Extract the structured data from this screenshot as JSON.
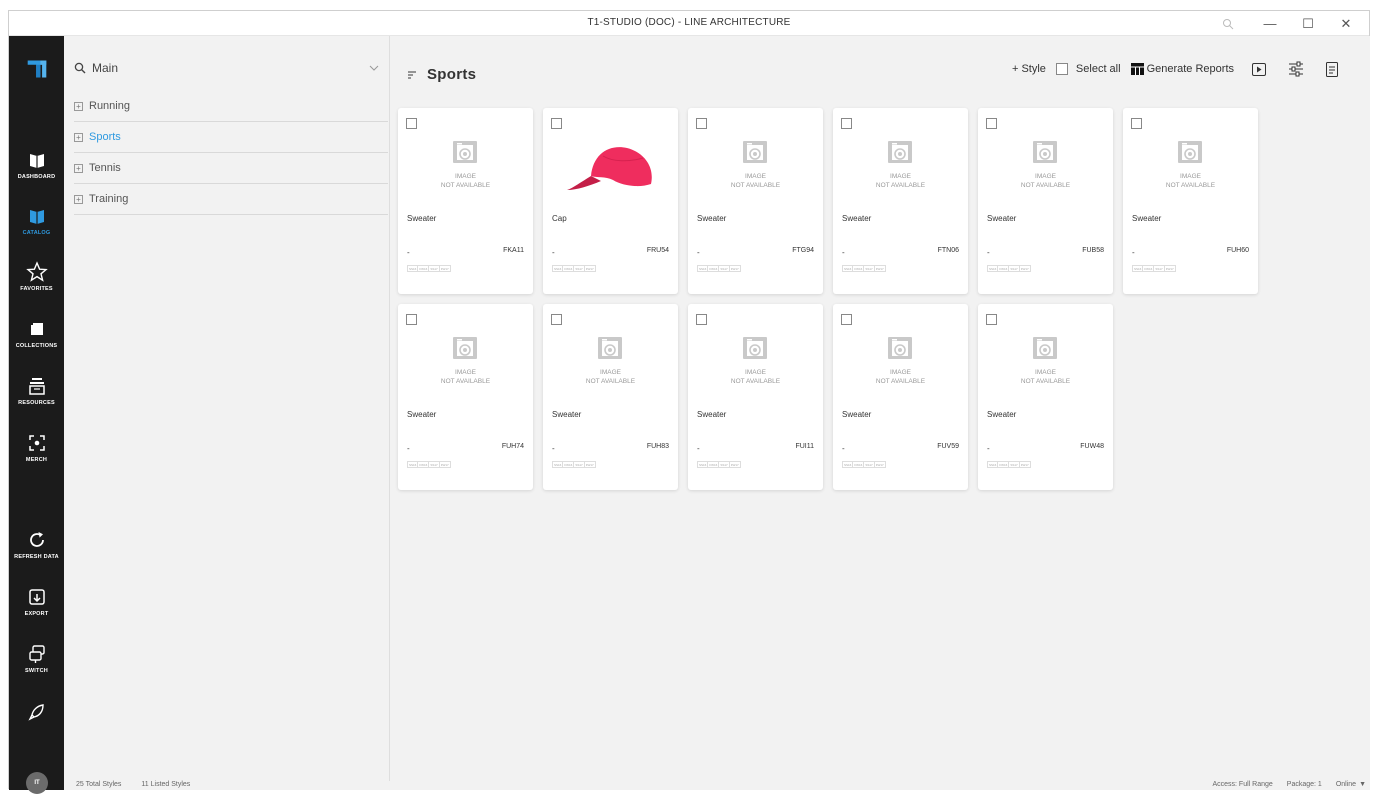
{
  "window": {
    "title": "T1-STUDIO (DOC) - LINE ARCHITECTURE",
    "zoom_icon": "magnifier-icon",
    "minimize_glyph": "—",
    "maximize_glyph": "☐",
    "close_glyph": "✕"
  },
  "rail": {
    "accent_color": "#2f9ae0",
    "items": [
      {
        "label": "DASHBOARD",
        "icon": "book-icon"
      },
      {
        "label": "CATALOG",
        "icon": "catalog-book-icon",
        "active": true
      },
      {
        "label": "FAVORITES",
        "icon": "star-icon"
      },
      {
        "label": "COLLECTIONS",
        "icon": "folder-icon"
      },
      {
        "label": "RESOURCES",
        "icon": "stack-icon"
      },
      {
        "label": "MERCH",
        "icon": "merch-icon"
      },
      {
        "label": "REFRESH DATA",
        "icon": "refresh-icon"
      },
      {
        "label": "EXPORT",
        "icon": "export-icon"
      },
      {
        "label": "SWITCH",
        "icon": "switch-icon"
      }
    ],
    "avatar_initials": "IT"
  },
  "tree": {
    "search_label": "Main",
    "items": [
      {
        "label": "Running"
      },
      {
        "label": "Sports",
        "active": true
      },
      {
        "label": "Tennis"
      },
      {
        "label": "Training"
      }
    ]
  },
  "main": {
    "title": "Sports",
    "toolbar": {
      "add_style": "+ Style",
      "select_all": "Select all",
      "generate_reports": "Generate Reports"
    }
  },
  "cards": [
    {
      "name": "Sweater",
      "code": "FKA11",
      "has_image": false
    },
    {
      "name": "Cap",
      "code": "FRU54",
      "has_image": true
    },
    {
      "name": "Sweater",
      "code": "FTG94",
      "has_image": false
    },
    {
      "name": "Sweater",
      "code": "FTN06",
      "has_image": false
    },
    {
      "name": "Sweater",
      "code": "FUB58",
      "has_image": false
    },
    {
      "name": "Sweater",
      "code": "FUH60",
      "has_image": false
    },
    {
      "name": "Sweater",
      "code": "FUH74",
      "has_image": false
    },
    {
      "name": "Sweater",
      "code": "FUH83",
      "has_image": false
    },
    {
      "name": "Sweater",
      "code": "FUI11",
      "has_image": false
    },
    {
      "name": "Sweater",
      "code": "FUV59",
      "has_image": false
    },
    {
      "name": "Sweater",
      "code": "FUW48",
      "has_image": false
    }
  ],
  "card_common": {
    "image_na_line1": "IMAGE",
    "image_na_line2": "NOT AVAILABLE",
    "dash": "-",
    "tags": [
      "SS16",
      "FW16",
      "SS17",
      "FW17"
    ],
    "cap_color": "#ef2d5e"
  },
  "status": {
    "total_styles": "25 Total Styles",
    "listed_styles": "11 Listed Styles",
    "access": "Access: Full Range",
    "package": "Package: 1",
    "online": "Online"
  }
}
